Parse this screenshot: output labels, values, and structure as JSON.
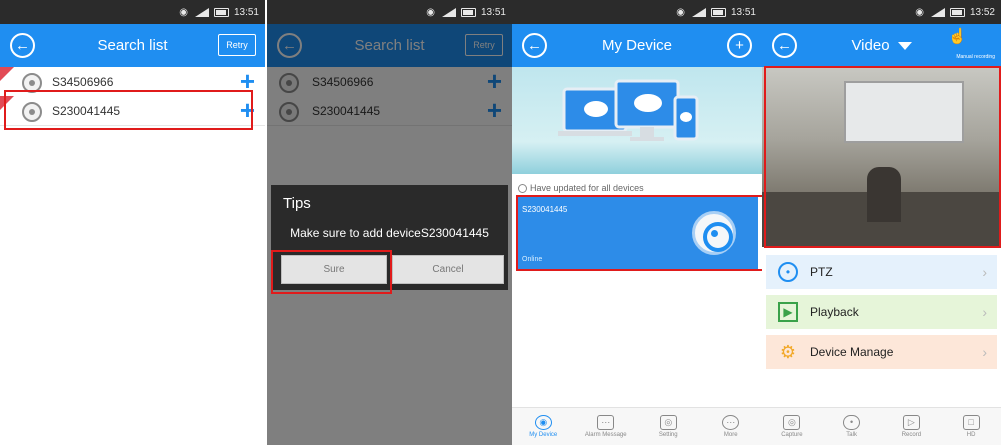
{
  "status_time_1": "13:51",
  "status_time_2": "13:51",
  "status_time_3": "13:51",
  "status_time_4": "13:52",
  "screen1": {
    "title": "Search list",
    "retry_label": "Retry",
    "devices": [
      "S34506966",
      "S230041445"
    ]
  },
  "screen2": {
    "title": "Search list",
    "retry_label": "Retry",
    "devices": [
      "S34506966",
      "S230041445"
    ],
    "dialog": {
      "title": "Tips",
      "message": "Make sure to add deviceS230041445",
      "sure_label": "Sure",
      "cancel_label": "Cancel"
    }
  },
  "screen3": {
    "title": "My Device",
    "updated_text": "Have updated for all devices",
    "device_id": "S230041445",
    "device_status": "Online",
    "tabs": [
      "My Device",
      "Alarm Message",
      "Setting",
      "More"
    ]
  },
  "screen4": {
    "title": "Video",
    "manual_recording": "Manual recording",
    "menu": [
      {
        "label": "PTZ",
        "icon": "ptz-icon",
        "bg": "#e5f1fc"
      },
      {
        "label": "Playback",
        "icon": "playback-icon",
        "bg": "#e6f5d9"
      },
      {
        "label": "Device Manage",
        "icon": "gear-icon",
        "bg": "#fde7d9"
      }
    ],
    "bottom_tabs": [
      "Capture",
      "Talk",
      "Record",
      "HD"
    ]
  },
  "colors": {
    "primary": "#1f8ef1",
    "highlight": "#e01b1b"
  }
}
